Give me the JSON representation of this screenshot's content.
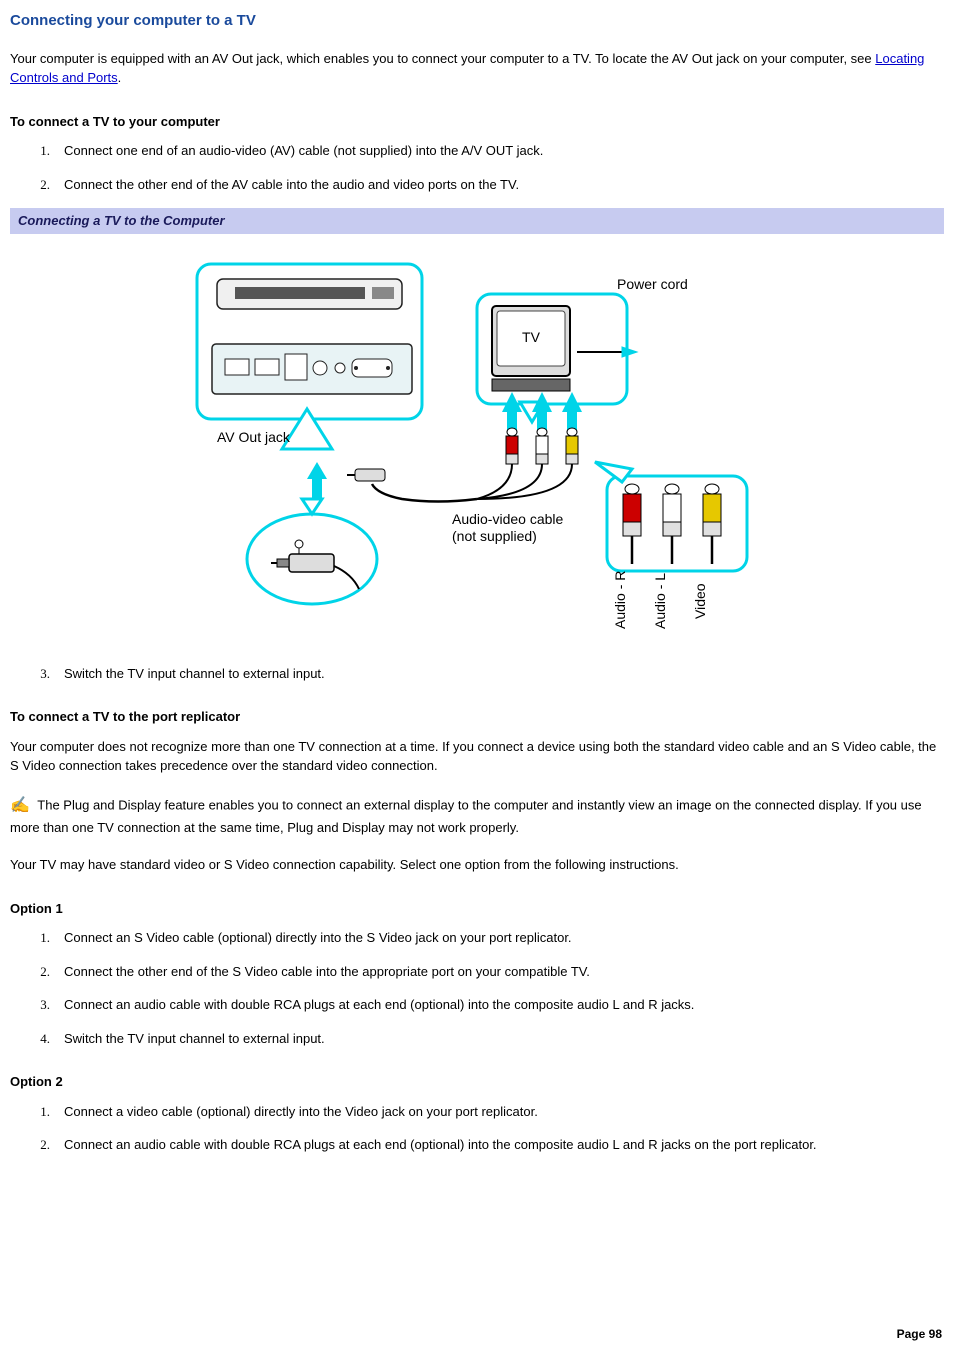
{
  "heading1": "Connecting your computer to a TV",
  "intro_before_link": "Your computer is equipped with an AV Out jack, which enables you to connect your computer to a TV. To locate the AV Out jack on your computer, see ",
  "intro_link_text": "Locating Controls and Ports",
  "intro_after_link": ".",
  "heading2a": "To connect a TV to your computer",
  "steps_a": {
    "s1": "Connect one end of an audio-video (AV) cable (not supplied) into the A/V OUT jack.",
    "s2": "Connect the other end of the AV cable into the audio and video ports on the TV.",
    "s3": "Switch the TV input channel to external input."
  },
  "figure_header": "Connecting a TV to the Computer",
  "figure_labels": {
    "power_cord": "Power cord",
    "tv": "TV",
    "av_out_jack": "AV Out jack",
    "av_cable_l1": "Audio-video cable",
    "av_cable_l2": "(not supplied)",
    "audio_r": "Audio - R",
    "audio_l": "Audio - L",
    "video": "Video"
  },
  "heading2b": "To connect a TV to the port replicator",
  "replicator_p1": "Your computer does not recognize more than one TV connection at a time. If you connect a device using both the standard video cable and an S Video cable, the S Video connection takes precedence over the standard video connection.",
  "note_text": " The Plug and Display feature enables you to connect an external display to the computer and instantly view an image on the connected display. If you use more than one TV connection at the same time, Plug and Display may not work properly.",
  "replicator_p2": "Your TV may have standard video or S Video connection capability. Select one option from the following instructions.",
  "option1_label": "Option 1",
  "option1_steps": {
    "s1": "Connect an S Video cable (optional) directly into the S Video jack on your port replicator.",
    "s2": "Connect the other end of the S Video cable into the appropriate port on your compatible TV.",
    "s3": "Connect an audio cable with double RCA plugs at each end (optional) into the composite audio L and R jacks.",
    "s4": "Switch the TV input channel to external input."
  },
  "option2_label": "Option 2",
  "option2_steps": {
    "s1": "Connect a video cable (optional) directly into the Video jack on your port replicator.",
    "s2": "Connect an audio cable with double RCA plugs at each end (optional) into the composite audio L and R jacks on the port replicator."
  },
  "page_number": "Page 98",
  "nums": {
    "n1": "1.",
    "n2": "2.",
    "n3": "3.",
    "n4": "4."
  }
}
